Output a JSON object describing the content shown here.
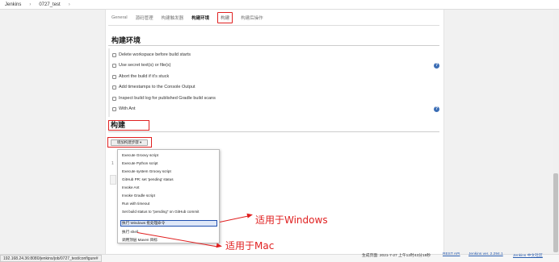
{
  "breadcrumb": {
    "home": "Jenkins",
    "job": "0727_test",
    "sep": "›"
  },
  "tabs": [
    "General",
    "源码管理",
    "构建触发器",
    "构建环境",
    "构建",
    "构建后操作"
  ],
  "build_env": {
    "title": "构建环境",
    "options": [
      "Delete workspace before build starts",
      "Use secret text(s) or file(s)",
      "Abort the build if it's stuck",
      "Add timestamps to the Console Output",
      "Inspect build log for published Gradle build scans",
      "With Ant"
    ]
  },
  "build": {
    "title": "构建",
    "add_step_label": "增加构建步骤 ▾",
    "stray": "1"
  },
  "dropdown_items": [
    "Execute Groovy script",
    "Execute Python script",
    "Execute system Groovy script",
    "GitHub PR: set 'pending' status",
    "Invoke Ant",
    "Invoke Gradle script",
    "Run with timeout",
    "Set build status to \"pending\" on GitHub commit",
    "执行 Windows 批处理命令",
    "执行 shell",
    "调用顶层 Maven 目标"
  ],
  "annotations": {
    "windows": "适用于Windows",
    "mac": "适用于Mac"
  },
  "status": {
    "url": "192.168.24.36:8080/jenkins/job/0727_test/configure#"
  },
  "footer": {
    "generated": "生成页面: 2021-7-27 上午12时43分18秒",
    "rest_api": "REST API",
    "version": "Jenkins ver. 2.294.1",
    "community": "Jenkins 中文社区"
  },
  "help_glyph": "?",
  "colors": {
    "highlight_red": "#e02020",
    "selected_blue": "#1f4fb0",
    "link_blue": "#2a5db0",
    "help_blue": "#3b6db5"
  }
}
